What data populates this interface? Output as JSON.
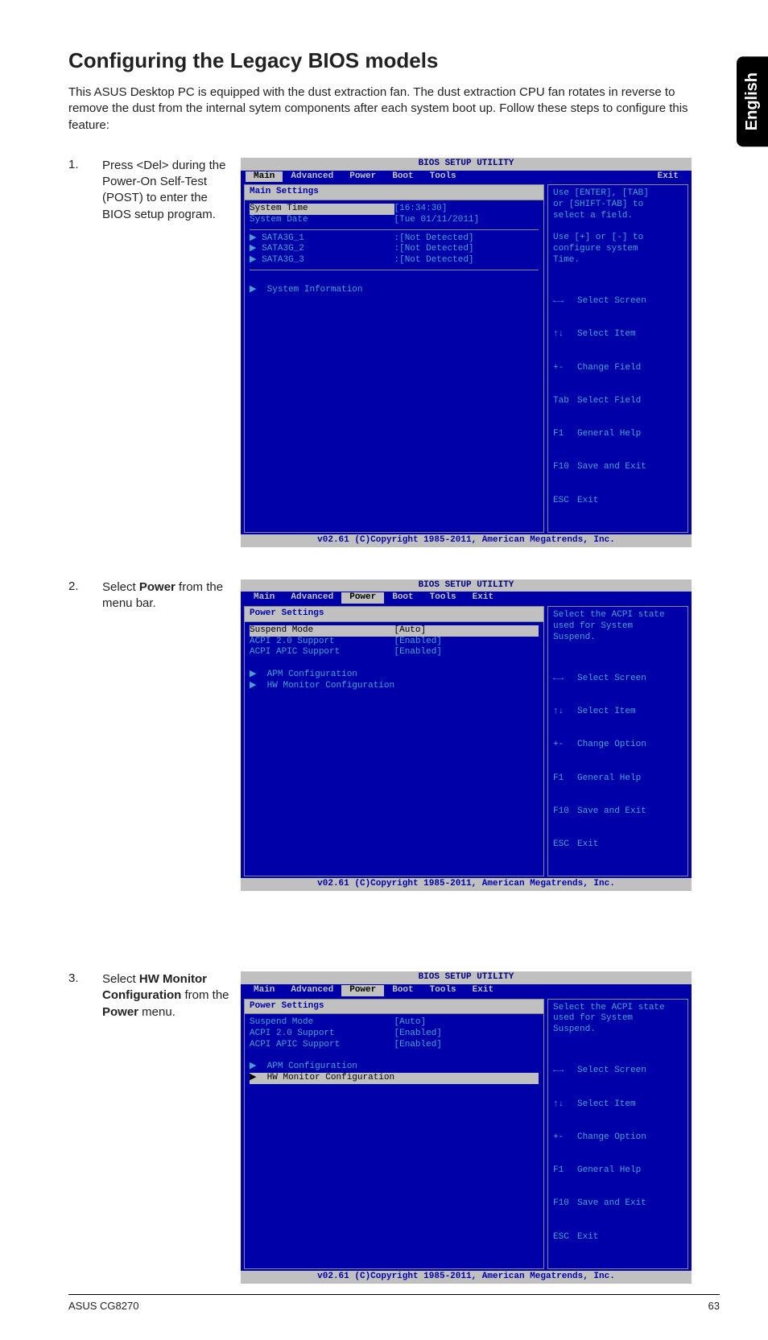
{
  "side_tab": "English",
  "title": "Configuring the Legacy BIOS models",
  "intro": "This ASUS Desktop PC is equipped with the dust extraction fan. The dust extraction CPU fan rotates in reverse to remove the dust from the internal sytem components after each system boot up. Follow these steps to configure this feature:",
  "steps": {
    "s1": {
      "num": "1.",
      "text": "Press <Del> during the Power-On Self-Test (POST) to enter the BIOS setup program."
    },
    "s2": {
      "num": "2.",
      "text_pre": "Select ",
      "text_bold": "Power",
      "text_post": " from the menu bar."
    },
    "s3": {
      "num": "3.",
      "text_pre": "Select ",
      "text_bold1": "HW Monitor Configuration",
      "text_mid": " from the ",
      "text_bold2": "Power",
      "text_post": " menu."
    }
  },
  "bios_common": {
    "title": "BIOS SETUP UTILITY",
    "footer": "v02.61 (C)Copyright 1985-2011, American Megatrends, Inc.",
    "menu": {
      "main": "Main",
      "advanced": "Advanced",
      "power": "Power",
      "boot": "Boot",
      "tools": "Tools",
      "exit": "Exit"
    }
  },
  "bios1": {
    "heading": "Main Settings",
    "rows": {
      "r1k": "System Time",
      "r1v": "[16:34:30]",
      "r2k": "System Date",
      "r2v": "[Tue 01/11/2011]",
      "r3k": "SATA3G_1",
      "r3v": ":[Not Detected]",
      "r4k": "SATA3G_2",
      "r4v": ":[Not Detected]",
      "r5k": "SATA3G_3",
      "r5v": ":[Not Detected]",
      "r6k": "System Information"
    },
    "help_top": "Use [ENTER], [TAB]\nor [SHIFT-TAB] to\nselect a field.\n\nUse [+] or [-] to\nconfigure system\nTime.",
    "keys": [
      [
        "←→",
        "Select Screen"
      ],
      [
        "↑↓",
        "Select Item"
      ],
      [
        "+-",
        "Change Field"
      ],
      [
        "Tab",
        "Select Field"
      ],
      [
        "F1",
        "General Help"
      ],
      [
        "F10",
        "Save and Exit"
      ],
      [
        "ESC",
        "Exit"
      ]
    ]
  },
  "bios2": {
    "heading": "Power Settings",
    "rows": {
      "r1k": "Suspend Mode",
      "r1v": "[Auto]",
      "r2k": "ACPI 2.0 Support",
      "r2v": "[Enabled]",
      "r3k": "ACPI APIC Support",
      "r3v": "[Enabled]",
      "r4k": "APM Configuration",
      "r5k": "HW Monitor Configuration"
    },
    "help_top": "Select the ACPI state\nused for System\nSuspend.",
    "keys": [
      [
        "←→",
        "Select Screen"
      ],
      [
        "↑↓",
        "Select Item"
      ],
      [
        "+-",
        "Change Option"
      ],
      [
        "F1",
        "General Help"
      ],
      [
        "F10",
        "Save and Exit"
      ],
      [
        "ESC",
        "Exit"
      ]
    ]
  },
  "bios3": {
    "heading": "Power Settings",
    "rows": {
      "r1k": "Suspend Mode",
      "r1v": "[Auto]",
      "r2k": "ACPI 2.0 Support",
      "r2v": "[Enabled]",
      "r3k": "ACPI APIC Support",
      "r3v": "[Enabled]",
      "r4k": "APM Configuration",
      "r5k": "HW Monitor Configuration"
    },
    "help_top": "Select the ACPI state\nused for System\nSuspend.",
    "keys": [
      [
        "←→",
        "Select Screen"
      ],
      [
        "↑↓",
        "Select Item"
      ],
      [
        "+-",
        "Change Option"
      ],
      [
        "F1",
        "General Help"
      ],
      [
        "F10",
        "Save and Exit"
      ],
      [
        "ESC",
        "Exit"
      ]
    ]
  },
  "footer": {
    "left": "ASUS CG8270",
    "right": "63"
  }
}
